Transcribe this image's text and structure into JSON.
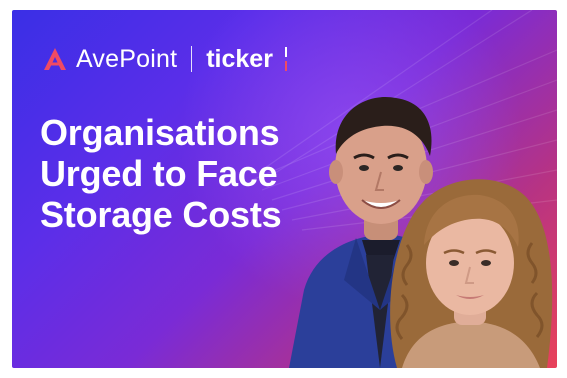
{
  "brand": {
    "avepoint_label": "AvePoint",
    "ticker_label": "ticker",
    "accent_color": "#e8425a"
  },
  "headline": {
    "lines": [
      "Organisations",
      "Urged to Face",
      "Storage Costs"
    ]
  },
  "photo": {
    "people": [
      "man-in-blue-suit",
      "woman-with-curly-hair"
    ]
  }
}
